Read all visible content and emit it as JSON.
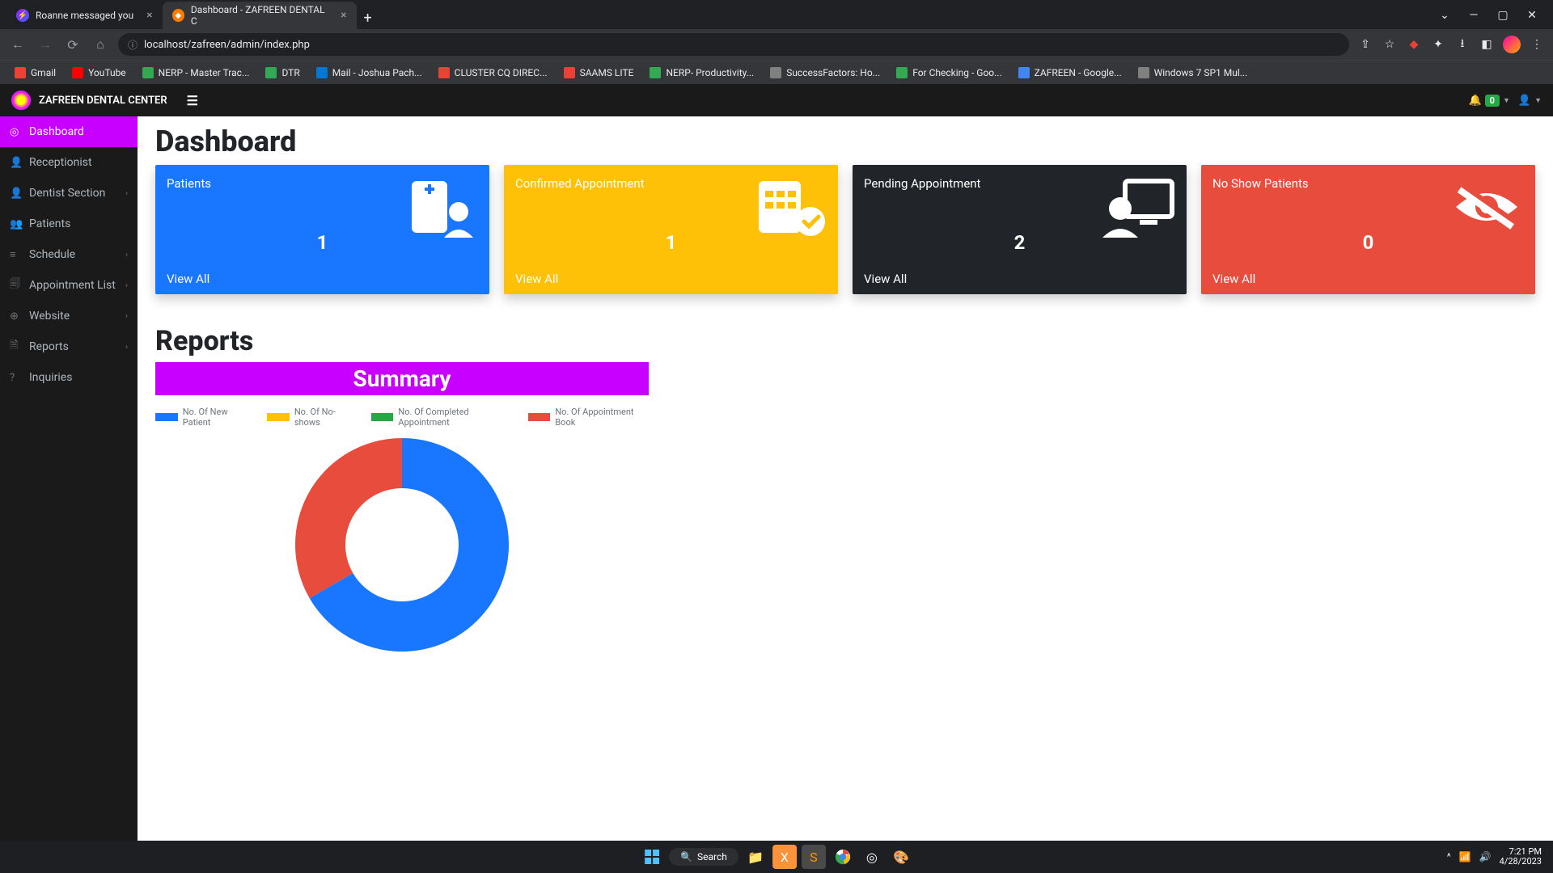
{
  "browser": {
    "tabs": [
      {
        "title": "Roanne messaged you",
        "active": false
      },
      {
        "title": "Dashboard - ZAFREEN DENTAL C",
        "active": true
      }
    ],
    "url": "localhost/zafreen/admin/index.php",
    "bookmarks": [
      {
        "label": "Gmail",
        "color": "#ea4335"
      },
      {
        "label": "YouTube",
        "color": "#ff0000"
      },
      {
        "label": "NERP - Master Trac...",
        "color": "#34a853"
      },
      {
        "label": "DTR",
        "color": "#34a853"
      },
      {
        "label": "Mail - Joshua Pach...",
        "color": "#0078d4"
      },
      {
        "label": "CLUSTER CQ DIREC...",
        "color": "#ea4335"
      },
      {
        "label": "SAAMS LITE",
        "color": "#ea4335"
      },
      {
        "label": "NERP- Productivity...",
        "color": "#34a853"
      },
      {
        "label": "SuccessFactors: Ho...",
        "color": "#808080"
      },
      {
        "label": "For Checking - Goo...",
        "color": "#34a853"
      },
      {
        "label": "ZAFREEN - Google...",
        "color": "#4285f4"
      },
      {
        "label": "Windows 7 SP1 Mul...",
        "color": "#808080"
      }
    ]
  },
  "header": {
    "brand": "ZAFREEN DENTAL CENTER",
    "notif_count": "0"
  },
  "sidebar": {
    "items": [
      {
        "label": "Dashboard",
        "icon": "◎",
        "active": true,
        "expandable": false
      },
      {
        "label": "Receptionist",
        "icon": "👤",
        "active": false,
        "expandable": false
      },
      {
        "label": "Dentist Section",
        "icon": "👤",
        "active": false,
        "expandable": true
      },
      {
        "label": "Patients",
        "icon": "👥",
        "active": false,
        "expandable": false
      },
      {
        "label": "Schedule",
        "icon": "≡",
        "active": false,
        "expandable": true
      },
      {
        "label": "Appointment List",
        "icon": "🗐",
        "active": false,
        "expandable": true
      },
      {
        "label": "Website",
        "icon": "⊕",
        "active": false,
        "expandable": true
      },
      {
        "label": "Reports",
        "icon": "🗎",
        "active": false,
        "expandable": true
      },
      {
        "label": "Inquiries",
        "icon": "?",
        "active": false,
        "expandable": false
      }
    ]
  },
  "main": {
    "title": "Dashboard",
    "cards": [
      {
        "label": "Patients",
        "count": "1",
        "link": "View All"
      },
      {
        "label": "Confirmed Appointment",
        "count": "1",
        "link": "View All"
      },
      {
        "label": "Pending Appointment",
        "count": "2",
        "link": "View All"
      },
      {
        "label": "No Show Patients",
        "count": "0",
        "link": "View All"
      }
    ],
    "reports_title": "Reports",
    "summary_title": "Summary"
  },
  "chart_data": {
    "type": "pie",
    "legend": [
      {
        "label": "No. Of New Patient",
        "color": "#1976ff"
      },
      {
        "label": "No. Of No-shows",
        "color": "#ffc107"
      },
      {
        "label": "No. Of Completed Appointment",
        "color": "#28a745"
      },
      {
        "label": "No. Of Appointment Book",
        "color": "#e74c3c"
      }
    ],
    "series": [
      {
        "name": "No. Of New Patient",
        "value": 2,
        "color": "#1976ff"
      },
      {
        "name": "No. Of Appointment Book",
        "value": 1,
        "color": "#e74c3c"
      }
    ]
  },
  "taskbar": {
    "search": "Search",
    "time": "7:21 PM",
    "date": "4/28/2023"
  }
}
